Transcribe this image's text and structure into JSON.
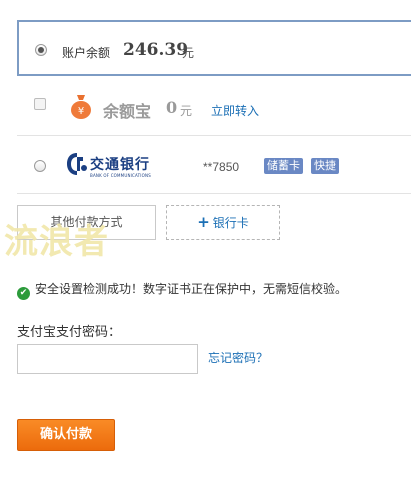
{
  "balance": {
    "label": "账户余额",
    "amount": "246.39",
    "unit": "元"
  },
  "yeb": {
    "icon": "money-bag-icon",
    "icon_glyph": "¥",
    "name": "余额宝",
    "amount": "0",
    "unit": "元",
    "transfer_link": "立即转入"
  },
  "bank": {
    "name_cn": "交通银行",
    "name_en": "BANK OF COMMUNICATIONS",
    "card_number": "**7850",
    "tags": [
      "储蓄卡",
      "快捷"
    ]
  },
  "actions": {
    "other_payment": "其他付款方式",
    "add_bank_plus": "+",
    "add_bank": "银行卡"
  },
  "watermark": "流浪者",
  "security": {
    "icon_glyph": "✔",
    "message": "安全设置检测成功！数字证书正在保护中，无需短信校验。"
  },
  "password": {
    "label": "支付宝支付密码：",
    "forgot": "忘记密码？"
  },
  "confirm": "确认付款",
  "colors": {
    "accent_orange": "#f98b26",
    "link_blue": "#1b6fb5",
    "selected_border": "#7d9cc4",
    "tag_blue": "#6a88c4",
    "success_green": "#2c9b3b"
  }
}
